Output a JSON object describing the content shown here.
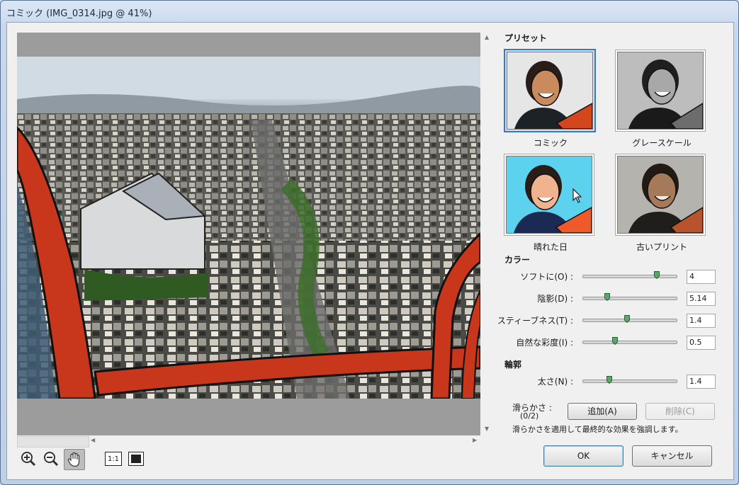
{
  "window": {
    "title": "コミック (IMG_0314.jpg @ 41%)"
  },
  "presets": {
    "heading": "プリセット",
    "items": [
      {
        "label": "コミック",
        "selected": true
      },
      {
        "label": "グレースケール",
        "selected": false
      },
      {
        "label": "晴れた日",
        "selected": false
      },
      {
        "label": "古いプリント",
        "selected": false
      }
    ]
  },
  "color": {
    "heading": "カラー",
    "sliders": [
      {
        "label": "ソフトに(O) :",
        "value": "4",
        "fraction": 0.79
      },
      {
        "label": "陰影(D) :",
        "value": "5.14",
        "fraction": 0.26
      },
      {
        "label": "スティーブネス(T) :",
        "value": "1.4",
        "fraction": 0.47
      },
      {
        "label": "自然な彩度(I) :",
        "value": "0.5",
        "fraction": 0.34
      }
    ]
  },
  "edge": {
    "heading": "輪郭",
    "sliders": [
      {
        "label": "太さ(N) :",
        "value": "1.4",
        "fraction": 0.28
      }
    ]
  },
  "smoothness": {
    "label": "滑らかさ :",
    "count": "(0/2)",
    "add_label": "追加(A)",
    "delete_label": "削除(C)",
    "description": "滑らかさを適用して最終的な効果を強調します。"
  },
  "buttons": {
    "ok": "OK",
    "cancel": "キャンセル"
  },
  "tools": {
    "one_to_one": "1:1"
  },
  "colors": {
    "accent": "#3a78c2",
    "frame_red": "#c8361c"
  }
}
